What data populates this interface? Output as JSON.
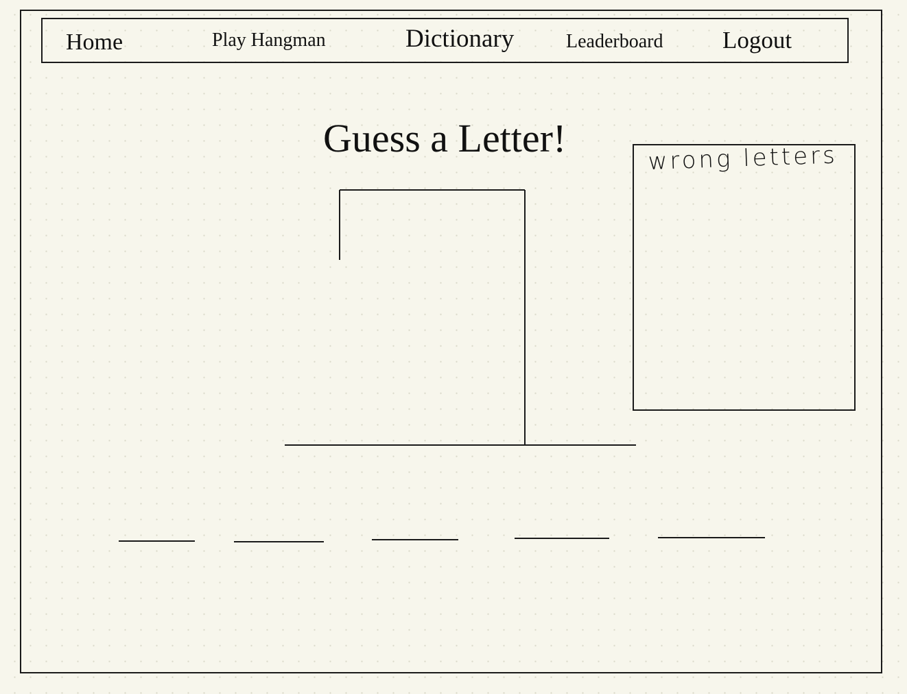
{
  "nav": {
    "home": "Home",
    "play_hangman": "Play Hangman",
    "dictionary": "Dictionary",
    "leaderboard": "Leaderboard",
    "logout": "Logout"
  },
  "main": {
    "title": "Guess a Letter!"
  },
  "wrong_letters": {
    "title": "wrong letters",
    "letters": []
  },
  "word": {
    "letter_count": 5,
    "revealed": [
      "",
      "",
      "",
      "",
      ""
    ]
  },
  "hangman": {
    "wrong_guesses": 0
  },
  "colors": {
    "background": "#f7f6ec",
    "ink": "#1a1a1a",
    "dot_grid": "#d9d8c8"
  }
}
